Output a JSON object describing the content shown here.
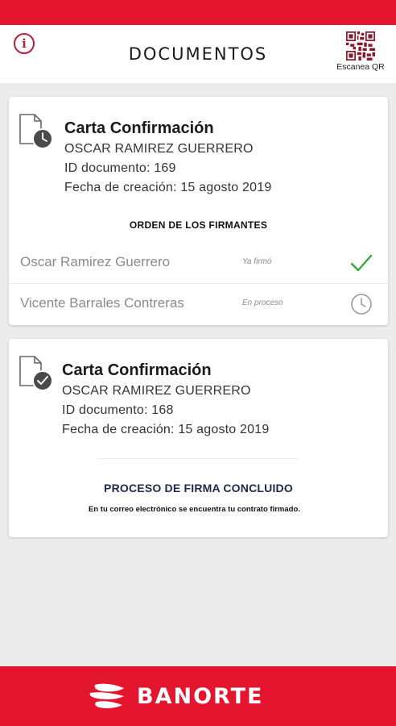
{
  "header": {
    "title": "DOCUMENTOS",
    "info_label": "i",
    "qr_label": "Escanea QR"
  },
  "documents": [
    {
      "name": "Carta Confirmación",
      "owner": "OSCAR RAMIREZ GUERRERO",
      "id_line": "ID documento: 169",
      "date_line": "Fecha de creación: 15 agosto 2019",
      "state_icon": "clock-pending",
      "signers_title": "ORDEN DE LOS FIRMANTES",
      "signers": [
        {
          "name": "Oscar Ramirez Guerrero",
          "status": "Ya firmó",
          "icon": "check-icon"
        },
        {
          "name": "Vicente Barrales Contreras",
          "status": "En proceso",
          "icon": "clock-icon"
        }
      ]
    },
    {
      "name": "Carta Confirmación",
      "owner": "OSCAR RAMIREZ GUERRERO",
      "id_line": "ID documento: 168",
      "date_line": "Fecha de creación: 15 agosto 2019",
      "state_icon": "check-complete",
      "concluded_title": "PROCESO DE FIRMA CONCLUIDO",
      "concluded_text": "En tu correo electrónico se encuentra tu contrato firmado."
    }
  ],
  "footer": {
    "brand": "BANORTE"
  },
  "colors": {
    "brand_red": "#e3152f",
    "check_green": "#3aa53a",
    "navy": "#1c2b4a"
  }
}
